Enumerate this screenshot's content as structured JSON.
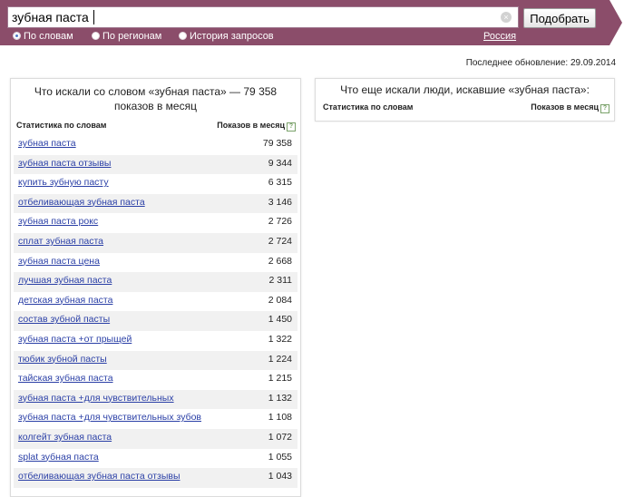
{
  "search": {
    "value": "зубная паста",
    "submit_label": "Подобрать",
    "modes": [
      {
        "label": "По словам",
        "selected": true
      },
      {
        "label": "По регионам",
        "selected": false
      },
      {
        "label": "История запросов",
        "selected": false
      }
    ],
    "region": "Россия"
  },
  "updated": "Последнее обновление: 29.09.2014",
  "left_panel": {
    "title": "Что искали со словом «зубная паста» — 79 358 показов в месяц",
    "col_keywords": "Статистика по словам",
    "col_shows": "Показов в месяц",
    "rows": [
      {
        "kw": "зубная паста",
        "n": "79 358"
      },
      {
        "kw": "зубная паста отзывы",
        "n": "9 344"
      },
      {
        "kw": "купить зубную пасту",
        "n": "6 315"
      },
      {
        "kw": "отбеливающая зубная паста",
        "n": "3 146"
      },
      {
        "kw": "зубная паста рокс",
        "n": "2 726"
      },
      {
        "kw": "сплат зубная паста",
        "n": "2 724"
      },
      {
        "kw": "зубная паста цена",
        "n": "2 668"
      },
      {
        "kw": "лучшая зубная паста",
        "n": "2 311"
      },
      {
        "kw": "детская зубная паста",
        "n": "2 084"
      },
      {
        "kw": "состав зубной пасты",
        "n": "1 450"
      },
      {
        "kw": "зубная паста +от прыщей",
        "n": "1 322"
      },
      {
        "kw": "тюбик зубной пасты",
        "n": "1 224"
      },
      {
        "kw": "тайская зубная паста",
        "n": "1 215"
      },
      {
        "kw": "зубная паста +для чувствительных",
        "n": "1 132"
      },
      {
        "kw": "зубная паста +для чувствительных зубов",
        "n": "1 108"
      },
      {
        "kw": "колгейт зубная паста",
        "n": "1 072"
      },
      {
        "kw": "splat зубная паста",
        "n": "1 055"
      },
      {
        "kw": "отбеливающая зубная паста отзывы",
        "n": "1 043"
      }
    ]
  },
  "right_panel": {
    "title": "Что еще искали люди, искавшие «зубная паста»:",
    "col_keywords": "Статистика по словам",
    "col_shows": "Показов в месяц"
  },
  "icons": {
    "clear": "clear-icon",
    "help": "help-icon"
  }
}
